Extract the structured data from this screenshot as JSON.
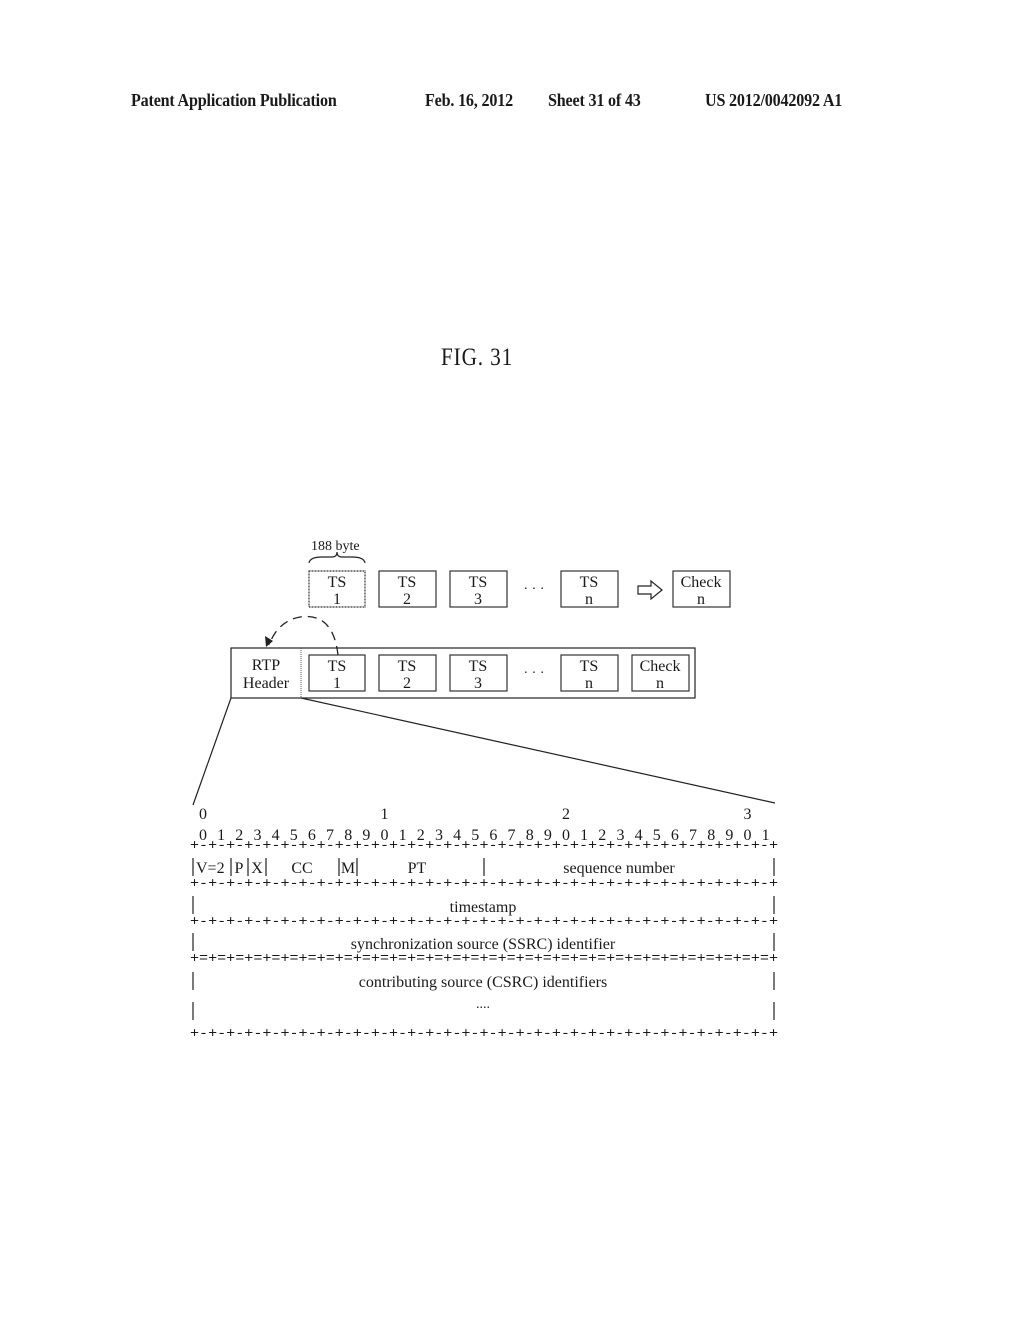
{
  "header": {
    "publication": "Patent Application Publication",
    "date": "Feb. 16, 2012",
    "sheet": "Sheet 31 of 43",
    "number": "US 2012/0042092 A1"
  },
  "figure": {
    "title": "FIG. 31",
    "byte_label": "188 byte",
    "top_row": {
      "packets": [
        {
          "line1": "TS",
          "line2": "1"
        },
        {
          "line1": "TS",
          "line2": "2"
        },
        {
          "line1": "TS",
          "line2": "3"
        },
        {
          "line1": "TS",
          "line2": "n"
        }
      ],
      "ellipsis": "· · ·",
      "check": {
        "line1": "Check",
        "line2": "n"
      }
    },
    "rtp_row": {
      "header": {
        "line1": "RTP",
        "line2": "Header"
      },
      "packets": [
        {
          "line1": "TS",
          "line2": "1"
        },
        {
          "line1": "TS",
          "line2": "2"
        },
        {
          "line1": "TS",
          "line2": "3"
        },
        {
          "line1": "TS",
          "line2": "n"
        }
      ],
      "ellipsis": "· · ·",
      "check": {
        "line1": "Check",
        "line2": "n"
      }
    },
    "rtp_header_layout": {
      "tens_digits": [
        "0",
        "1",
        "2",
        "3"
      ],
      "bit_digits": [
        "0",
        "1",
        "2",
        "3",
        "4",
        "5",
        "6",
        "7",
        "8",
        "9",
        "0",
        "1",
        "2",
        "3",
        "4",
        "5",
        "6",
        "7",
        "8",
        "9",
        "0",
        "1",
        "2",
        "3",
        "4",
        "5",
        "6",
        "7",
        "8",
        "9",
        "0",
        "1"
      ],
      "row1_fields": [
        "V=2",
        "P",
        "X",
        "CC",
        "M",
        "PT",
        "sequence number"
      ],
      "row2_field": "timestamp",
      "row3_field": "synchronization source (SSRC) identifier",
      "row4_field": "contributing source (CSRC) identifiers",
      "row5_field": "...."
    }
  }
}
